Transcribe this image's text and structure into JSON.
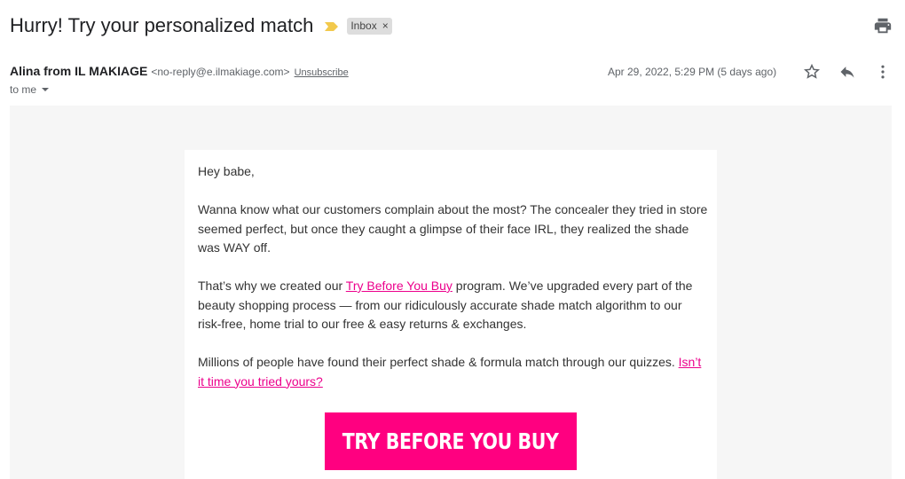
{
  "header": {
    "subject": "Hurry! Try your personalized match",
    "label": "Inbox",
    "label_remove": "×",
    "icons": {
      "importance": "importance-marker-icon",
      "print": "print-icon"
    }
  },
  "message": {
    "sender_name": "Alina from IL MAKIAGE",
    "sender_email": "<no-reply@e.ilmakiage.com>",
    "unsubscribe": "Unsubscribe",
    "recipient": "to me",
    "date": "Apr 29, 2022, 5:29 PM (5 days ago)",
    "icons": {
      "star": "star-icon",
      "reply": "reply-icon",
      "more": "more-vert-icon"
    }
  },
  "body": {
    "greeting": "Hey babe,",
    "p1": "Wanna know what our customers complain about the most? The concealer they tried in store seemed perfect, but once they caught a glimpse of their face IRL, they realized the shade was WAY off.",
    "p2_before": "That’s why we created our ",
    "p2_link": "Try Before You Buy",
    "p2_after": " program. We’ve upgraded every part of the beauty shopping process — from our ridiculously accurate shade match algorithm to our risk-free, home trial to our free & easy returns & exchanges.",
    "p3_before": "Millions of people have found their perfect shade & formula match through our quizzes. ",
    "p3_link": "Isn’t it time you tried yours?",
    "cta": "TRY BEFORE YOU BUY"
  },
  "colors": {
    "brand_pink": "#ff0080",
    "link_pink": "#ec008c",
    "importance_yellow": "#f2c94c",
    "label_bg": "#dddddd"
  }
}
